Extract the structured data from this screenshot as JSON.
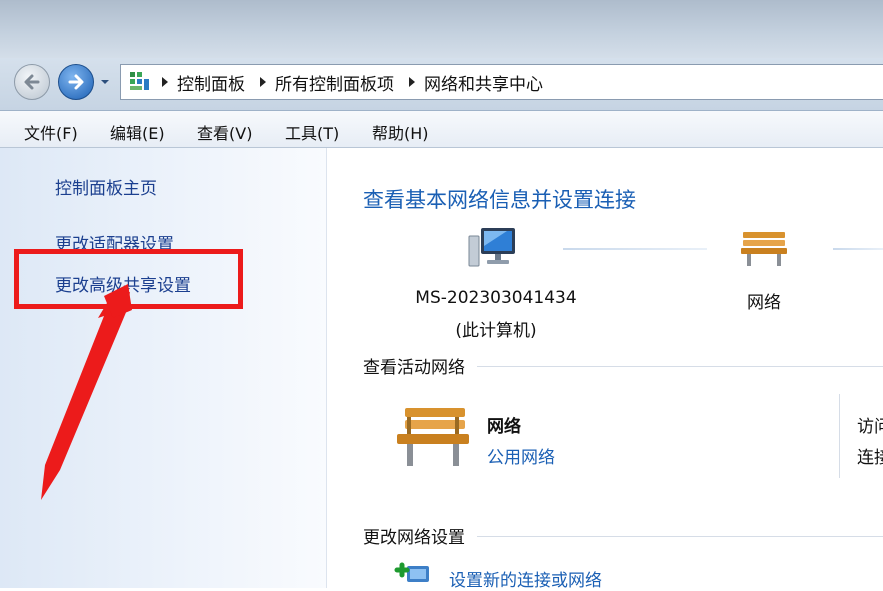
{
  "breadcrumb": [
    "控制面板",
    "所有控制面板项",
    "网络和共享中心"
  ],
  "menu": [
    "文件(F)",
    "编辑(E)",
    "查看(V)",
    "工具(T)",
    "帮助(H)"
  ],
  "sidebar": {
    "items": [
      {
        "label": "控制面板主页"
      },
      {
        "label": "更改适配器设置"
      },
      {
        "label": "更改高级共享设置"
      }
    ]
  },
  "main": {
    "title": "查看基本网络信息并设置连接",
    "network_map": {
      "computer_name": "MS-202303041434",
      "computer_sub": "(此计算机)",
      "network_label": "网络"
    },
    "active_networks": {
      "heading": "查看活动网络",
      "name": "网络",
      "type": "公用网络",
      "access_label": "访问",
      "connection_label": "连接"
    },
    "change_settings": {
      "heading": "更改网络设置",
      "new_connection_link": "设置新的连接或网络"
    }
  },
  "colors": {
    "link": "#1a5fb4",
    "annotation_red": "#ec1b1b"
  }
}
